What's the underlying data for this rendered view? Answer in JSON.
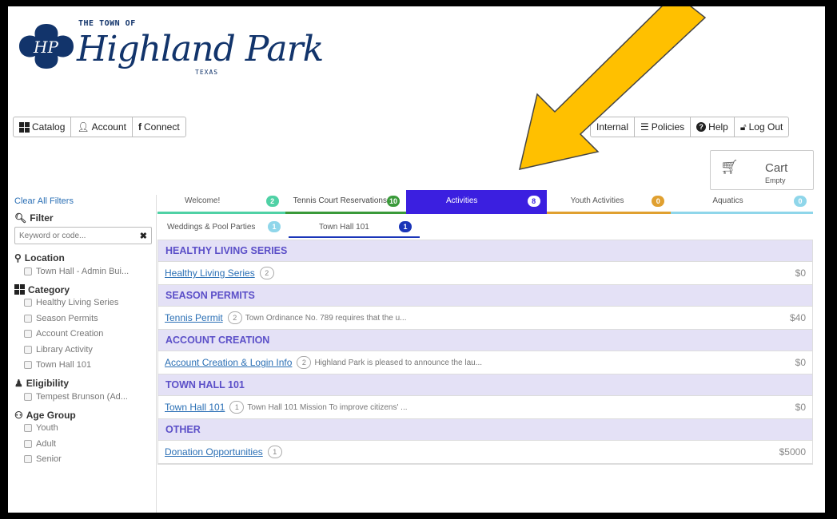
{
  "header": {
    "logo_small": "THE TOWN OF",
    "logo_script": "Highland Park",
    "logo_state": "TEXAS"
  },
  "nav_left": [
    {
      "label": "Catalog",
      "icon": "grid-icon"
    },
    {
      "label": "Account",
      "icon": "user-icon"
    },
    {
      "label": "Connect",
      "icon": "facebook-icon"
    }
  ],
  "nav_right": [
    {
      "label": "Internal",
      "icon": "none"
    },
    {
      "label": "Policies",
      "icon": "policies-icon"
    },
    {
      "label": "Help",
      "icon": "help-icon"
    },
    {
      "label": "Log Out",
      "icon": "lock-icon"
    }
  ],
  "cart": {
    "label": "Cart",
    "status": "Empty"
  },
  "sidebar": {
    "clear_filters": "Clear All Filters",
    "filter_label": "Filter",
    "search_placeholder": "Keyword or code...",
    "location_label": "Location",
    "location_items": [
      "Town Hall - Admin Bui..."
    ],
    "category_label": "Category",
    "category_items": [
      "Healthy Living Series",
      "Season Permits",
      "Account Creation",
      "Library Activity",
      "Town Hall 101"
    ],
    "eligibility_label": "Eligibility",
    "eligibility_items": [
      "Tempest Brunson (Ad..."
    ],
    "age_label": "Age Group",
    "age_items": [
      "Youth",
      "Adult",
      "Senior"
    ]
  },
  "tabs": [
    {
      "label": "Welcome!",
      "count": "2",
      "color": "#4fd1a5"
    },
    {
      "label": "Tennis Court Reservations",
      "count": "10",
      "color": "#3a9a3a"
    },
    {
      "label": "Activities",
      "count": "8",
      "color": "#3b1fe0"
    },
    {
      "label": "Youth Activities",
      "count": "0",
      "color": "#e0a030"
    },
    {
      "label": "Aquatics",
      "count": "0",
      "color": "#8fd6ea"
    }
  ],
  "subtabs": [
    {
      "label": "Weddings & Pool Parties",
      "count": "1",
      "color": "#8fd6ea"
    },
    {
      "label": "Town Hall 101",
      "count": "1",
      "color": "#1a35b8"
    }
  ],
  "categories": [
    {
      "title": "HEALTHY LIVING SERIES",
      "items": [
        {
          "name": "Healthy Living Series",
          "count": "2",
          "desc": "",
          "price": "$0"
        }
      ]
    },
    {
      "title": "SEASON PERMITS",
      "items": [
        {
          "name": "Tennis Permit",
          "count": "2",
          "desc": "Town Ordinance No. 789 requires that the u...",
          "price": "$40"
        }
      ]
    },
    {
      "title": "ACCOUNT CREATION",
      "items": [
        {
          "name": "Account Creation & Login Info",
          "count": "2",
          "desc": "Highland Park is pleased to announce the lau...",
          "price": "$0"
        }
      ]
    },
    {
      "title": "TOWN HALL 101",
      "items": [
        {
          "name": "Town Hall 101",
          "count": "1",
          "desc": "Town Hall 101 Mission  To improve citizens' ...",
          "price": "$0"
        }
      ]
    },
    {
      "title": "OTHER",
      "items": [
        {
          "name": "Donation Opportunities",
          "count": "1",
          "desc": "",
          "price": "$5000"
        }
      ]
    }
  ],
  "colors": {
    "accent": "#5b4fc8",
    "link": "#2a6fb5",
    "arrow": "#ffc000"
  }
}
